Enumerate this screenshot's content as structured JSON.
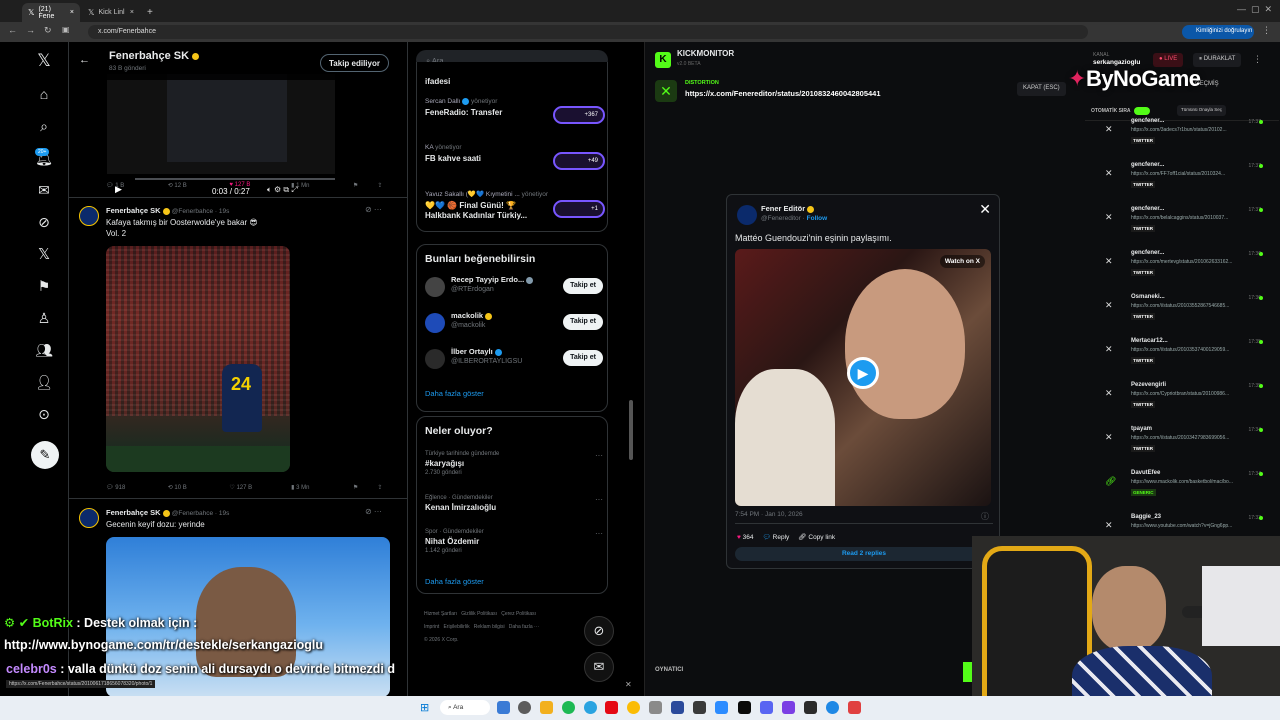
{
  "browser": {
    "tabs": [
      {
        "label": "(21) Fene"
      },
      {
        "label": "Kick Linl"
      }
    ],
    "url": "x.com/Fenerbahce",
    "verify_label": "Kimliğinizi doğrulayın"
  },
  "profile": {
    "name": "Fenerbahçe SK",
    "posts_count": "83 B gönderi",
    "follow_state": "Takip ediliyor"
  },
  "video_post": {
    "time": "0:03 / 0:27",
    "actions": [
      "1 B",
      "12 B",
      "127 B",
      "1 Mn"
    ]
  },
  "tweets": [
    {
      "name": "Fenerbahçe SK",
      "handle": "@Fenerbahce · 19s",
      "text_line1": "Kafaya takmış bir Oosterwolde'ye bakar 😎",
      "text_line2": "Vol. 2",
      "image_caption": "24",
      "actions": [
        "918",
        "10 B",
        "127 B",
        "3 Mn"
      ]
    },
    {
      "name": "Fenerbahçe SK",
      "handle": "@Fenerbahce · 19s",
      "text_line1": "Gecenin keyif dozu: yerinde"
    }
  ],
  "search_placeholder": "Ara",
  "spaces": [
    {
      "host": "",
      "title": "ifadesi"
    },
    {
      "host": "Sercan Dallı",
      "role": "yönetiyor",
      "title": "FeneRadio: Transfer",
      "count": "+367"
    },
    {
      "host": "KA",
      "role": "yönetiyor",
      "title": "FB kahve saati",
      "count": "+49"
    },
    {
      "host": "Yavuz Sakallı (💛💙 Kıymetini ...",
      "role": "yönetiyor",
      "title_line1": "💛💙 🏀 Final Günü! 🏆",
      "title_line2": "Halkbank Kadınlar Türkiy...",
      "count": "+1"
    }
  ],
  "who_to_follow": {
    "title": "Bunları beğenebilirsin",
    "items": [
      {
        "name": "Recep Tayyip Erdo...",
        "handle": "@RTErdogan",
        "button": "Takip et"
      },
      {
        "name": "mackolik",
        "handle": "@mackolik",
        "button": "Takip et"
      },
      {
        "name": "İlber Ortaylı",
        "handle": "@ILBERORTAYLIGSU",
        "button": "Takip et"
      }
    ],
    "more": "Daha fazla göster"
  },
  "trends": {
    "title": "Neler oluyor?",
    "items": [
      {
        "context": "Türkiye tarihinde gündemde",
        "topic": "#karyağışı",
        "posts": "2.730 gönderi"
      },
      {
        "context": "Eğlence · Gündemdekiler",
        "topic": "Kenan İmirzalıoğlu",
        "posts": ""
      },
      {
        "context": "Spor · Gündemdekiler",
        "topic": "Nihat Özdemir",
        "posts": "1.142 gönderi"
      }
    ],
    "more": "Daha fazla göster"
  },
  "footer_links": [
    "Hizmet Şartları",
    "Gizlilik Politikası",
    "Çerez Politikası",
    "Imprint",
    "Erişilebilirlik",
    "Reklam bilgisi",
    "Daha fazla ···",
    "© 2026 X Corp."
  ],
  "status_url": "https://x.com/Fenerbahce/status/2010061718656078320/photo/1",
  "kick": {
    "app_title": "KICKMONITOR",
    "version": "v2.0 BETA",
    "source_label": "DISTORTION",
    "current_url": "https://x.com/Fenereditor/status/2010832460042805441",
    "close_label": "KAPAT (ESC)",
    "channel_label": "KANAL",
    "channel": "serkangazioglu",
    "live_label": "LIVE",
    "stop_label": "DURAKLAT",
    "history_label": "GEÇMİŞ",
    "auto_label": "OTOMATİK SIRA",
    "clear_label": "Tümünü Onayla Seç",
    "player_label": "OYNATICI"
  },
  "feed": [
    {
      "name": "gencfener...",
      "url": "https://x.com/3adecs7r1bun/status/20102...",
      "tag": "TWITTER",
      "time": "17:37"
    },
    {
      "name": "gencfener...",
      "url": "https://x.com/FF7off1cial/status/2010324...",
      "tag": "TWITTER",
      "time": "17:37"
    },
    {
      "name": "gencfener...",
      "url": "https://x.com/belalcaggins/status/2010037...",
      "tag": "TWITTER",
      "time": "17:37"
    },
    {
      "name": "gencfener...",
      "url": "https://x.com/mertevg/status/201062633162...",
      "tag": "TWITTER",
      "time": "17:36"
    },
    {
      "name": "Osmaneki...",
      "url": "https://x.com/i/status/20103552867546685...",
      "tag": "TWITTER",
      "time": "17:36"
    },
    {
      "name": "Mertacar12...",
      "url": "https://x.com/i/status/20103537400129059...",
      "tag": "TWITTER",
      "time": "17:35"
    },
    {
      "name": "Pezevengirli",
      "url": "https://x.com/Cypriotbran/status/20100986...",
      "tag": "TWITTER",
      "time": "17:35"
    },
    {
      "name": "tpayam",
      "url": "https://x.com/i/status/20103427983699056...",
      "tag": "TWITTER",
      "time": "17:34"
    },
    {
      "name": "DavutEfee",
      "url": "https://www.mackolik.com/basketbol/mac/bo...",
      "tag": "GENERIC",
      "time": "17:34"
    },
    {
      "name": "Baggie_23",
      "url": "https://www.youtube.com/watch?v=jGng6pp...",
      "tag": "",
      "time": "17:33"
    }
  ],
  "embed": {
    "name": "Fener Editör",
    "handle": "@Fenereditor",
    "follow": "Follow",
    "text": "Mattéo Guendouzi'nin eşinin paylaşımı.",
    "watch_label": "Watch on X",
    "timestamp": "7:54 PM · Jan 10, 2026",
    "likes": "364",
    "reply": "Reply",
    "copy_link": "Copy link",
    "read_replies": "Read 2 replies"
  },
  "watermark": "ByNoGame",
  "chat": [
    {
      "user": "BotRix",
      "text": ": Destek olmak için :"
    },
    {
      "user": "",
      "text": "http://www.bynogame.com/tr/destekle/serkangazioglu"
    },
    {
      "user": "celebr0s",
      "text": ": valla dünkü doz senin ali dursaydı o devirde bitmezdi d"
    }
  ],
  "taskbar_search": "Ara",
  "colors": {
    "x_blue": "#1d9bf0",
    "kick_green": "#53fc18",
    "like_pink": "#f91880",
    "live_red": "#e0245e"
  }
}
